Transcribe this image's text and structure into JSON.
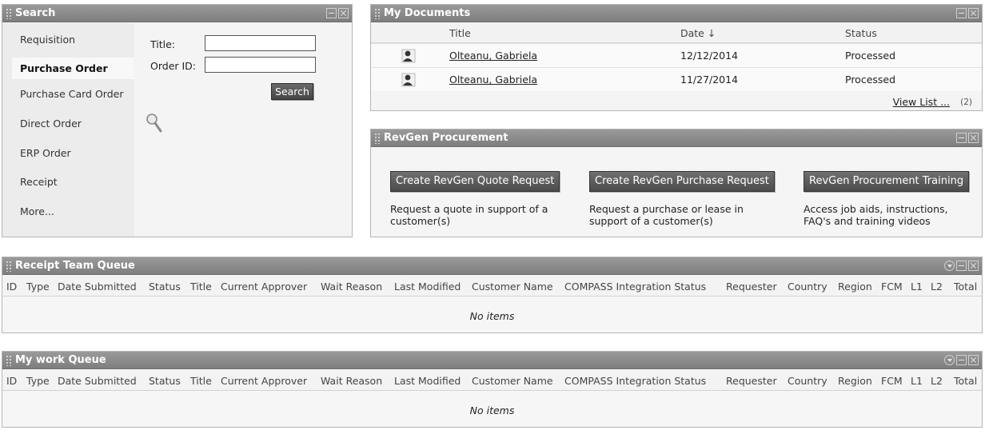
{
  "search_panel": {
    "title": "Search",
    "nav": [
      "Requisition",
      "Purchase Order",
      "Purchase Card Order",
      "Direct Order",
      "ERP Order",
      "Receipt",
      "More..."
    ],
    "active": "Purchase Order",
    "title_label": "Title:",
    "order_id_label": "Order ID:",
    "title_value": "",
    "order_id_value": "",
    "search_button": "Search"
  },
  "documents": {
    "title": "My Documents",
    "columns": [
      "Title",
      "Date ↓",
      "Status"
    ],
    "rows": [
      {
        "title": "Olteanu, Gabriela",
        "date": "12/12/2014",
        "status": "Processed"
      },
      {
        "title": "Olteanu, Gabriela",
        "date": "11/27/2014",
        "status": "Processed"
      }
    ],
    "view_list": "View List ...",
    "count": "(2)"
  },
  "revgen": {
    "title": "RevGen Procurement",
    "buttons": [
      {
        "label": "Create RevGen Quote Request",
        "desc": "Request a quote in support of a customer(s)"
      },
      {
        "label": "Create RevGen Purchase Request",
        "desc": "Request a purchase or lease in support of a customer(s)"
      },
      {
        "label": "RevGen Procurement Training",
        "desc": "Access job aids, instructions, FAQ's and training videos"
      }
    ]
  },
  "queue_columns": [
    "ID",
    "Type",
    "Date Submitted",
    "Status",
    "Title",
    "Current Approver",
    "Wait Reason",
    "Last Modified",
    "Customer Name",
    "COMPASS Integration Status",
    "Requester",
    "Country",
    "Region",
    "FCM",
    "L1",
    "L2",
    "Total"
  ],
  "receipt_queue": {
    "title": "Receipt Team Queue",
    "empty": "No items"
  },
  "work_queue": {
    "title": "My work Queue",
    "empty": "No items"
  },
  "colors": {
    "header": "#888888",
    "panel_bg": "#f4f4f4",
    "button": "#555555"
  },
  "icons": [
    "grip-icon",
    "minimize-icon",
    "close-icon",
    "dropdown-icon",
    "magnifier-icon",
    "person-icon"
  ]
}
